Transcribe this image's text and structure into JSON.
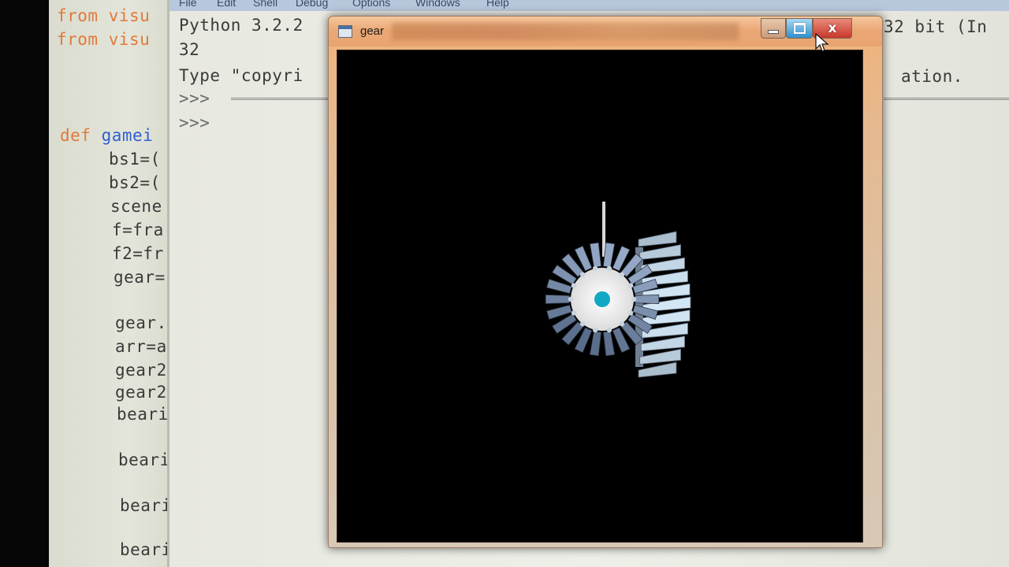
{
  "editor": {
    "lines": [
      {
        "segments": [
          {
            "text": "from visu",
            "cls": "kw"
          }
        ]
      },
      {
        "segments": [
          {
            "text": "from visu",
            "cls": "kw"
          }
        ]
      },
      {
        "segments": [
          {
            "text": "def ",
            "cls": "kw"
          },
          {
            "text": "gamei",
            "cls": "fn"
          }
        ]
      },
      {
        "segments": [
          {
            "text": "bs1=(",
            "cls": ""
          }
        ]
      },
      {
        "segments": [
          {
            "text": "bs2=(",
            "cls": ""
          }
        ]
      },
      {
        "segments": [
          {
            "text": "scene",
            "cls": ""
          }
        ]
      },
      {
        "segments": [
          {
            "text": "f=fra",
            "cls": ""
          }
        ]
      },
      {
        "segments": [
          {
            "text": "f2=fr",
            "cls": ""
          }
        ]
      },
      {
        "segments": [
          {
            "text": "gear=",
            "cls": ""
          }
        ]
      },
      {
        "segments": [
          {
            "text": "gear.",
            "cls": ""
          }
        ]
      },
      {
        "segments": [
          {
            "text": "arr=a",
            "cls": ""
          }
        ]
      },
      {
        "segments": [
          {
            "text": "gear2",
            "cls": ""
          }
        ]
      },
      {
        "segments": [
          {
            "text": "gear2",
            "cls": ""
          }
        ]
      },
      {
        "segments": [
          {
            "text": "beari",
            "cls": ""
          }
        ]
      },
      {
        "segments": [
          {
            "text": "beari",
            "cls": ""
          }
        ]
      },
      {
        "segments": [
          {
            "text": "beari",
            "cls": ""
          }
        ]
      },
      {
        "segments": [
          {
            "text": "beari",
            "cls": ""
          }
        ]
      }
    ]
  },
  "shell": {
    "menu": [
      "File",
      "Edit",
      "Shell",
      "Debug",
      "Options",
      "Windows",
      "Help"
    ],
    "version_line": "Python 3.2.2",
    "version_line_tail": "32 bit (In",
    "arch_line": "32",
    "license_line": "Type \"copyri",
    "license_line_tail": "ation.",
    "prompt_1": ">>> ",
    "prompt_2": ">>>"
  },
  "gear_window": {
    "title": "gear",
    "minimize_icon": "minimize-icon",
    "maximize_icon": "maximize-icon",
    "close_icon": "close-icon",
    "close_label": "x",
    "canvas_bg": "#000000",
    "gear_hub_color": "#12a8c4",
    "gear_face_color": "#f2f2f2",
    "teeth_color": "#8da4bd"
  },
  "colors": {
    "keyword": "#e07a3a",
    "function_name": "#2f5fd0",
    "title_bar": "#eba877",
    "close_button": "#c8382a",
    "maximize_button": "#2f8fcf"
  }
}
